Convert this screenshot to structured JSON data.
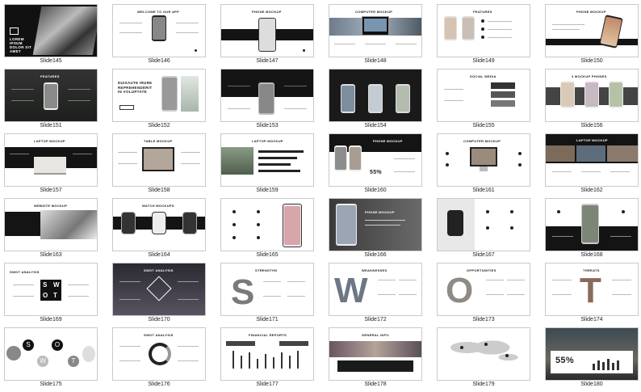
{
  "slides": [
    {
      "label": "Slide145",
      "title": "LOREM IPSUM DOLOR SIT AMET"
    },
    {
      "label": "Slide146",
      "title": "WELCOME TO OUR APP"
    },
    {
      "label": "Slide147",
      "title": "PHONE MOCKUP"
    },
    {
      "label": "Slide148",
      "title": "COMPUTER MOCKUP"
    },
    {
      "label": "Slide149",
      "title": "FEATURES"
    },
    {
      "label": "Slide150",
      "title": "PHONE MOCKUP"
    },
    {
      "label": "Slide151",
      "title": "FEATURES"
    },
    {
      "label": "Slide152",
      "title": "DUISAUTE IRURE REPREHENDERIT IN VOLUPTATE"
    },
    {
      "label": "Slide153",
      "title": ""
    },
    {
      "label": "Slide154",
      "title": ""
    },
    {
      "label": "Slide155",
      "title": "SOCIAL MEDIA"
    },
    {
      "label": "Slide156",
      "title": "3 MOCKUP PHONES"
    },
    {
      "label": "Slide157",
      "title": "LAPTOP MOCKUP"
    },
    {
      "label": "Slide158",
      "title": "TABLE MOCKUP"
    },
    {
      "label": "Slide159",
      "title": "LAPTOP MOCKUP"
    },
    {
      "label": "Slide160",
      "title": "PHONE MOCKUP"
    },
    {
      "label": "Slide161",
      "title": "COMPUTER MOCKUP"
    },
    {
      "label": "Slide162",
      "title": "LAPTOP MOCKUP"
    },
    {
      "label": "Slide163",
      "title": "WEBSITE MOCKUP"
    },
    {
      "label": "Slide164",
      "title": "WATCH MOCKUPS"
    },
    {
      "label": "Slide165",
      "title": ""
    },
    {
      "label": "Slide166",
      "title": "PHONE MOCKUP"
    },
    {
      "label": "Slide167",
      "title": ""
    },
    {
      "label": "Slide168",
      "title": ""
    },
    {
      "label": "Slide169",
      "title": "SWOT ANALYSIS"
    },
    {
      "label": "Slide170",
      "title": "SWOT ANALYSIS"
    },
    {
      "label": "Slide171",
      "title": "STRENGTHS"
    },
    {
      "label": "Slide172",
      "title": "WEAKNESSES"
    },
    {
      "label": "Slide173",
      "title": "OPPORTUNITIES"
    },
    {
      "label": "Slide174",
      "title": "THREATS"
    },
    {
      "label": "Slide175",
      "title": ""
    },
    {
      "label": "Slide176",
      "title": "SWOT ANALYSIS"
    },
    {
      "label": "Slide177",
      "title": "FINANCIAL REPORTS"
    },
    {
      "label": "Slide178",
      "title": "GENERAL INFO"
    },
    {
      "label": "Slide179",
      "title": ""
    },
    {
      "label": "Slide180",
      "title": ""
    }
  ],
  "misc": {
    "swot_letters": [
      "S",
      "W",
      "O",
      "T"
    ],
    "percent_160": "55%",
    "percent_180": "55%",
    "letter_171": "S",
    "letter_172": "W",
    "letter_173": "O",
    "letter_174": "T"
  }
}
